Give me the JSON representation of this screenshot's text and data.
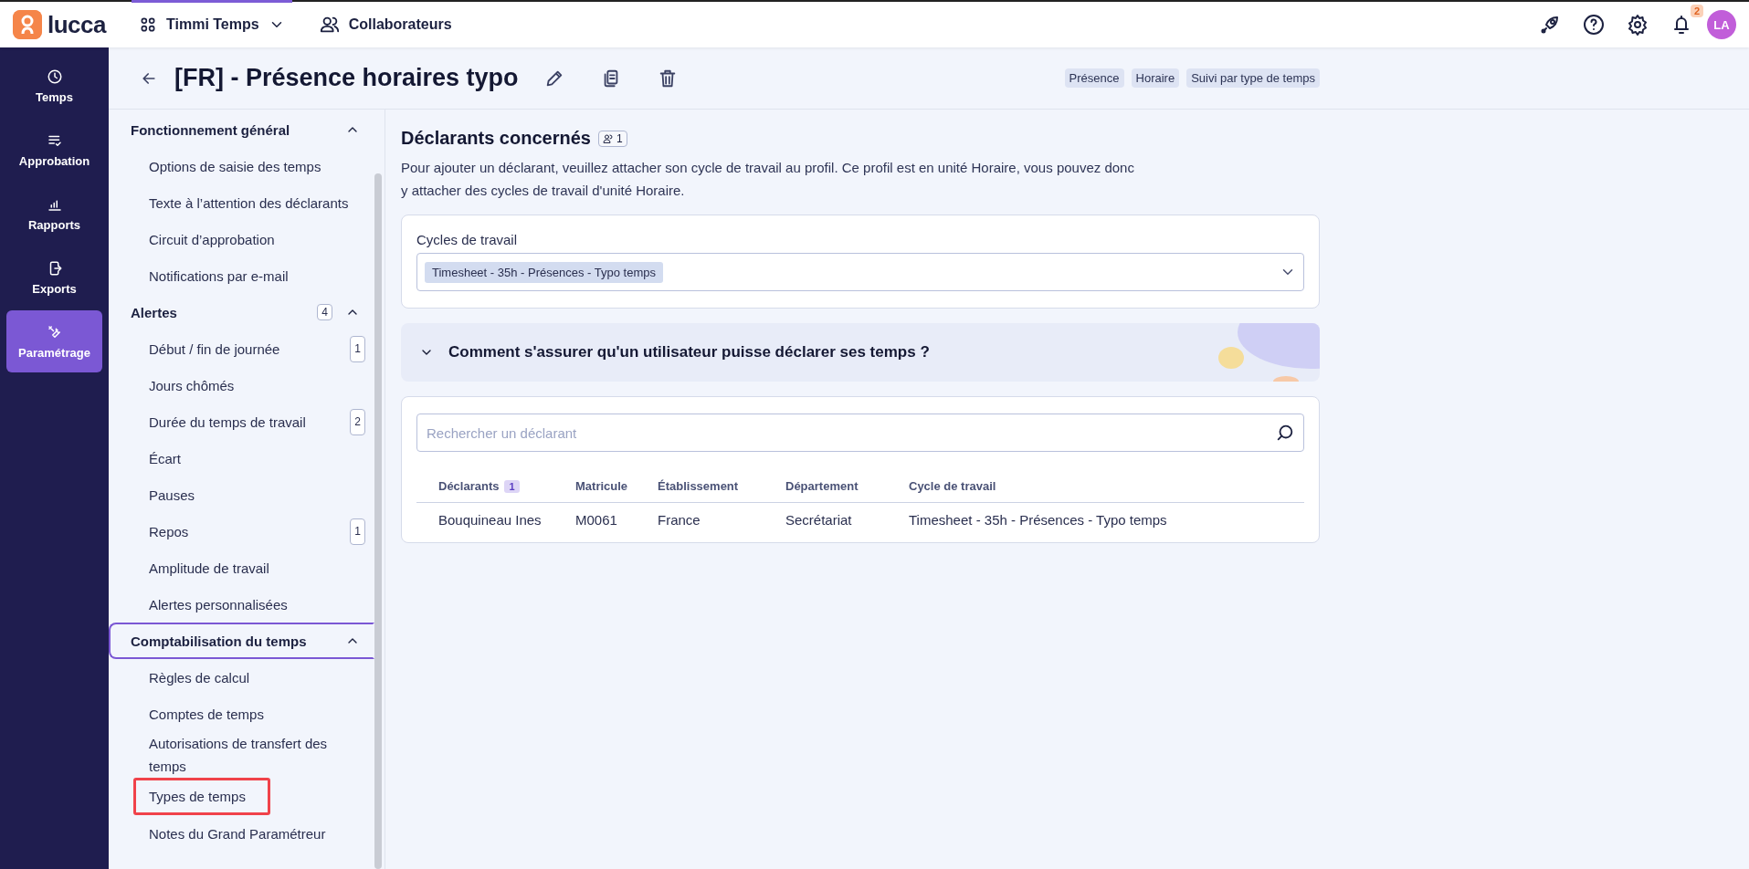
{
  "topbar": {
    "logo_text": "lucca",
    "app_switcher": {
      "label": "Timmi Temps"
    },
    "links": [
      {
        "label": "Collaborateurs"
      }
    ],
    "notification_count": "2",
    "avatar": "LA"
  },
  "nav": {
    "items": [
      {
        "label": "Temps",
        "selected": false
      },
      {
        "label": "Approbation",
        "selected": false
      },
      {
        "label": "Rapports",
        "selected": false
      },
      {
        "label": "Exports",
        "selected": false
      },
      {
        "label": "Paramétrage",
        "selected": true
      }
    ]
  },
  "header": {
    "title": "[FR] - Présence horaires typo",
    "tags": [
      "Présence",
      "Horaire",
      "Suivi par type de temps"
    ]
  },
  "sidebar": {
    "sections": [
      {
        "title": "Fonctionnement général",
        "expanded": true,
        "selected": false,
        "items": [
          {
            "label": "Options de saisie des temps",
            "highlighted": false
          },
          {
            "label": "Texte à l’attention des déclarants",
            "highlighted": false
          },
          {
            "label": "Circuit d’approbation",
            "highlighted": false
          },
          {
            "label": "Notifications par e-mail",
            "highlighted": false
          }
        ]
      },
      {
        "title": "Alertes",
        "count": "4",
        "expanded": true,
        "selected": false,
        "items": [
          {
            "label": "Début / fin de journée",
            "count": "1",
            "highlighted": false
          },
          {
            "label": "Jours chômés",
            "highlighted": false
          },
          {
            "label": "Durée du temps de travail",
            "count": "2",
            "highlighted": false
          },
          {
            "label": "Écart",
            "highlighted": false
          },
          {
            "label": "Pauses",
            "highlighted": false
          },
          {
            "label": "Repos",
            "count": "1",
            "highlighted": false
          },
          {
            "label": "Amplitude de travail",
            "highlighted": false
          },
          {
            "label": "Alertes personnalisées",
            "highlighted": false
          }
        ]
      },
      {
        "title": "Comptabilisation du temps",
        "expanded": true,
        "selected": true,
        "items": [
          {
            "label": "Règles de calcul",
            "highlighted": false
          },
          {
            "label": "Comptes de temps",
            "highlighted": false
          },
          {
            "label": "Autorisations de transfert des temps",
            "highlighted": false
          },
          {
            "label": "Types de temps",
            "highlighted": true
          },
          {
            "label": "Notes du Grand Paramétreur",
            "highlighted": false
          }
        ]
      }
    ]
  },
  "main": {
    "heading": "Déclarants concernés",
    "heading_count": "1",
    "description": "Pour ajouter un déclarant, veuillez attacher son cycle de travail au profil. Ce profil est en unité Horaire, vous pouvez donc y attacher des cycles de travail d'unité Horaire.",
    "cycles_field": {
      "label": "Cycles de travail",
      "chips": [
        "Timesheet - 35h - Présences - Typo temps"
      ]
    },
    "accordion": {
      "title": "Comment s'assurer qu'un utilisateur puisse déclarer ses temps ?",
      "expanded": false
    },
    "search": {
      "placeholder": "Rechercher un déclarant"
    },
    "table": {
      "columns": [
        {
          "label": "Déclarants",
          "count": "1"
        },
        {
          "label": "Matricule"
        },
        {
          "label": "Établissement"
        },
        {
          "label": "Département"
        },
        {
          "label": "Cycle de travail"
        }
      ],
      "rows": [
        [
          "Bouquineau Ines",
          "M0061",
          "France",
          "Secrétariat",
          "Timesheet - 35h - Présences - Typo temps"
        ]
      ]
    }
  }
}
